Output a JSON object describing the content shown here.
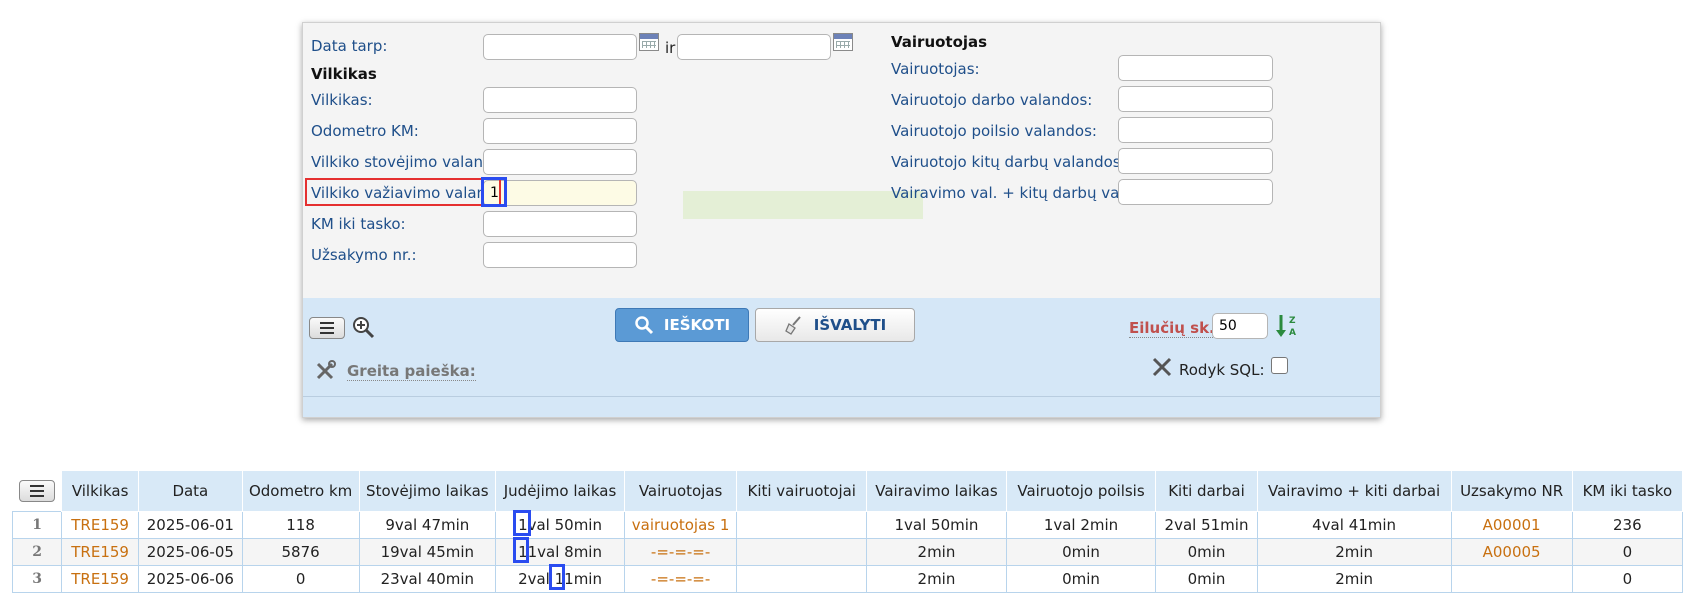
{
  "filter": {
    "date_between_label": "Data tarp:",
    "and_label": "ir",
    "truck_header": "Vilkikas",
    "driver_header": "Vairuotojas",
    "left_fields": [
      {
        "label": "Vilkikas:",
        "value": ""
      },
      {
        "label": "Odometro KM:",
        "value": ""
      },
      {
        "label": "Vilkiko stovėjimo valandos:",
        "value": ""
      },
      {
        "label": "Vilkiko važiavimo valandos:",
        "value": "1"
      },
      {
        "label": "KM iki tasko:",
        "value": ""
      },
      {
        "label": "Užsakymo nr.:",
        "value": ""
      }
    ],
    "right_fields": [
      {
        "label": "Vairuotojas:",
        "value": ""
      },
      {
        "label": "Vairuotojo darbo valandos:",
        "value": ""
      },
      {
        "label": "Vairuotojo poilsio valandos:",
        "value": ""
      },
      {
        "label": "Vairuotojo kitų darbų valandos:",
        "value": ""
      },
      {
        "label": "Vairavimo val. + kitų darbų val.:",
        "value": ""
      }
    ]
  },
  "toolbar": {
    "search_label": "IEŠKOTI",
    "clear_label": "IŠVALYTI",
    "rows_label": "Eilučių sk.:",
    "rows_value": "50",
    "sort_icon_text": "Z A",
    "quick_search_label": "Greita paieška:",
    "show_sql_label": "Rodyk SQL:"
  },
  "table": {
    "columns": [
      "Vilkikas",
      "Data",
      "Odometro km",
      "Stovėjimo laikas",
      "Judėjimo laikas",
      "Vairuotojas",
      "Kiti vairuotojai",
      "Vairavimo laikas",
      "Vairuotojo poilsis",
      "Kiti darbai",
      "Vairavimo + kiti darbai",
      "Uzsakymo NR",
      "KM iki tasko"
    ],
    "rows": [
      {
        "n": "1",
        "cells": [
          "TRE159",
          "2025-06-01",
          "118",
          "9val 47min",
          "1val 50min",
          "vairuotojas 1",
          "",
          "1val 50min",
          "1val 2min",
          "2val 51min",
          "4val 41min",
          "A00001",
          "236"
        ]
      },
      {
        "n": "2",
        "cells": [
          "TRE159",
          "2025-06-05",
          "5876",
          "19val 45min",
          "11val 8min",
          "-=-=-=-",
          "",
          "2min",
          "0min",
          "0min",
          "2min",
          "A00005",
          "0"
        ]
      },
      {
        "n": "3",
        "cells": [
          "TRE159",
          "2025-06-06",
          "0",
          "23val 40min",
          "2val 11min",
          "-=-=-=-",
          "",
          "2min",
          "0min",
          "0min",
          "2min",
          "",
          "0"
        ]
      }
    ]
  }
}
